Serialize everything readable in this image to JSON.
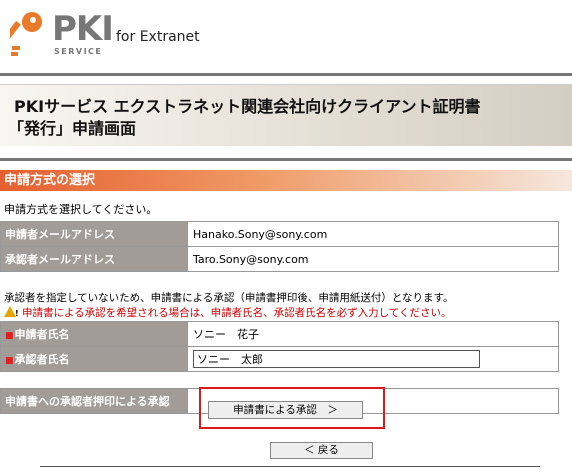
{
  "header": {
    "logo_text": "PKI",
    "logo_sub": "SERVICE",
    "subtitle": "for Extranet"
  },
  "title": {
    "line1": "PKIサービス エクストラネット関連会社向けクライアント証明書",
    "line2": "「発行」申請画面"
  },
  "section": {
    "heading": "申請方式の選択",
    "instruction": "申請方式を選択してください。"
  },
  "emails": [
    {
      "label": "申請者メールアドレス",
      "value": "Hanako.Sony@sony.com"
    },
    {
      "label": "承認者メールアドレス",
      "value": "Taro.Sony@sony.com"
    }
  ],
  "notes": {
    "line1": "承認者を指定していないため、申請書による承認（申請書押印後、申請用紙送付）となります。",
    "line2": "申請書による承認を希望される場合は、申請者氏名、承認者氏名を必ず入力してください。"
  },
  "names": {
    "applicant_label": "申請者氏名",
    "applicant_value": "ソニー　花子",
    "approver_label": "承認者氏名",
    "approver_value": "ソニー　太郎",
    "required_mark": "■"
  },
  "approval": {
    "label": "申請書への承認者押印による承認",
    "button": "申請書による承認　＞"
  },
  "back_button": "＜ 戻る",
  "colors": {
    "section_accent": "#e65e2f",
    "label_bg": "#a19c97",
    "highlight_border": "#d81c1c"
  }
}
